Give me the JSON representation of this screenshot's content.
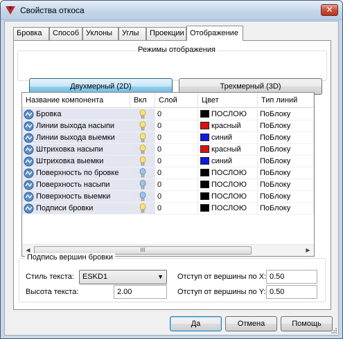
{
  "window": {
    "title": "Свойства откоса",
    "close_label": "✕"
  },
  "tabs": [
    "Бровка",
    "Способ",
    "Уклоны",
    "Углы",
    "Проекции",
    "Отображение"
  ],
  "active_tab": 5,
  "display_modes": {
    "title": "Режимы отображения",
    "mode_2d": "Двухмерный (2D)",
    "mode_3d": "Трехмерный (3D)",
    "selected": "2D"
  },
  "grid": {
    "columns": [
      "Название компонента",
      "Вкл",
      "Слой",
      "Цвет",
      "Тип линий"
    ],
    "rows": [
      {
        "name": "Бровка",
        "on": true,
        "layer": "0",
        "color": "ПОСЛОЮ",
        "swatch": "#000000",
        "linetype": "ПоБлоку"
      },
      {
        "name": "Линии выхода насыпи",
        "on": true,
        "layer": "0",
        "color": "красный",
        "swatch": "#e01010",
        "linetype": "ПоБлоку"
      },
      {
        "name": "Линии выхода выемки",
        "on": true,
        "layer": "0",
        "color": "синий",
        "swatch": "#1018e0",
        "linetype": "ПоБлоку"
      },
      {
        "name": "Штриховка насыпи",
        "on": true,
        "layer": "0",
        "color": "красный",
        "swatch": "#e01010",
        "linetype": "ПоБлоку"
      },
      {
        "name": "Штриховка выемки",
        "on": true,
        "layer": "0",
        "color": "синий",
        "swatch": "#1018e0",
        "linetype": "ПоБлоку"
      },
      {
        "name": "Поверхность по бровке",
        "on": false,
        "layer": "0",
        "color": "ПОСЛОЮ",
        "swatch": "#000000",
        "linetype": "ПоБлоку"
      },
      {
        "name": "Поверхность насыпи",
        "on": false,
        "layer": "0",
        "color": "ПОСЛОЮ",
        "swatch": "#000000",
        "linetype": "ПоБлоку"
      },
      {
        "name": "Поверхность выемки",
        "on": false,
        "layer": "0",
        "color": "ПОСЛОЮ",
        "swatch": "#000000",
        "linetype": "ПоБлоку"
      },
      {
        "name": "Подписи бровки",
        "on": true,
        "layer": "0",
        "color": "ПОСЛОЮ",
        "swatch": "#000000",
        "linetype": "ПоБлоку"
      }
    ],
    "scroll_grip": "III"
  },
  "signature": {
    "title": "Подпись вершин бровки",
    "text_style_label": "Стиль текста:",
    "text_style_value": "ESKD1",
    "text_height_label": "Высота текста:",
    "text_height_value": "2.00",
    "offset_x_label": "Отступ от вершины по X:",
    "offset_x_value": "0.50",
    "offset_y_label": "Отступ от вершины по Y:",
    "offset_y_value": "0.50"
  },
  "buttons": {
    "ok": "Да",
    "cancel": "Отмена",
    "help": "Помощь"
  }
}
